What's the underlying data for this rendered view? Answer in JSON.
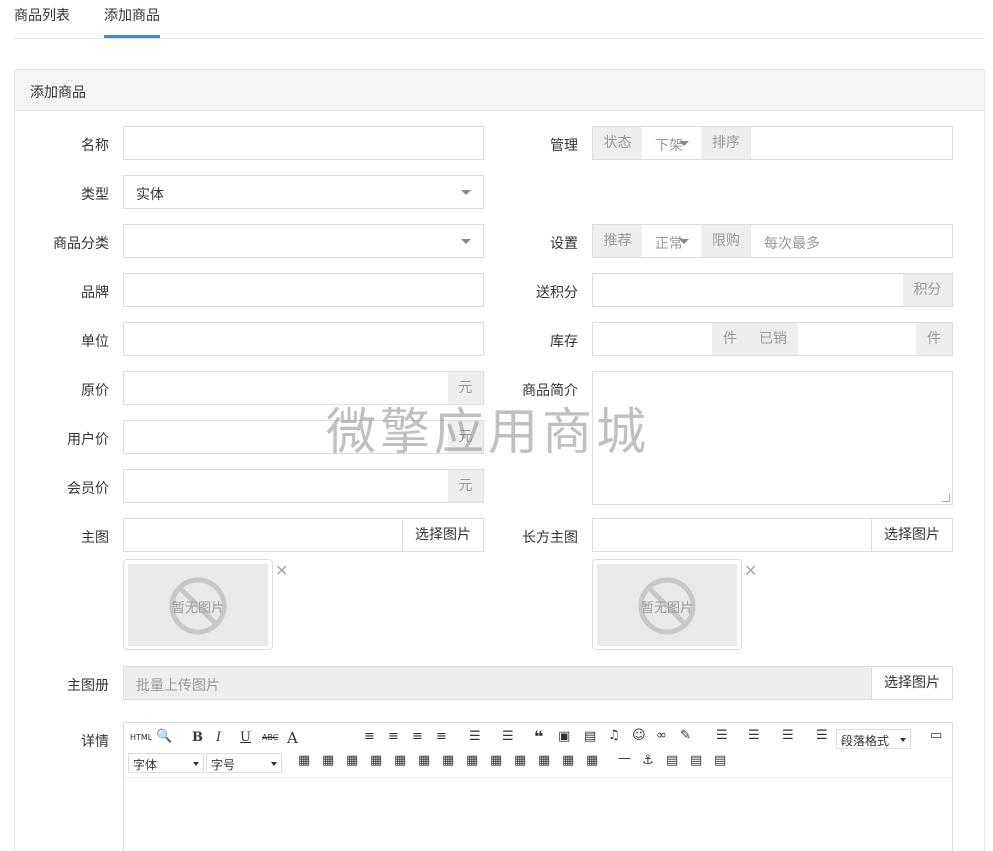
{
  "tabs": [
    "商品列表",
    "添加商品"
  ],
  "panel_title": "添加商品",
  "watermark": "微擎应用商城",
  "fields": {
    "name": "名称",
    "type": "类型",
    "type_value": "实体",
    "category": "商品分类",
    "brand": "品牌",
    "unit": "单位",
    "price_original": "原价",
    "price_user": "用户价",
    "price_member": "会员价",
    "currency": "元",
    "main_image": "主图",
    "select_image": "选择图片",
    "gallery": "主图册",
    "gallery_placeholder": "批量上传图片",
    "detail": "详情",
    "manage": "管理",
    "status": "状态",
    "status_value": "下架",
    "sort": "排序",
    "settings": "设置",
    "recommend": "推荐",
    "recommend_value": "正常",
    "limit": "限购",
    "limit_placeholder": "每次最多",
    "points": "送积分",
    "points_unit": "积分",
    "stock": "库存",
    "piece": "件",
    "sold": "已销",
    "intro": "商品简介",
    "wide_image": "长方主图",
    "no_image": "暂无图片"
  },
  "editor": {
    "html": "HTML",
    "bold": "B",
    "italic": "I",
    "underline": "U",
    "strike": "ABC",
    "fontcolor": "A",
    "paragraph": "段落格式",
    "font": "字体",
    "size": "字号"
  }
}
